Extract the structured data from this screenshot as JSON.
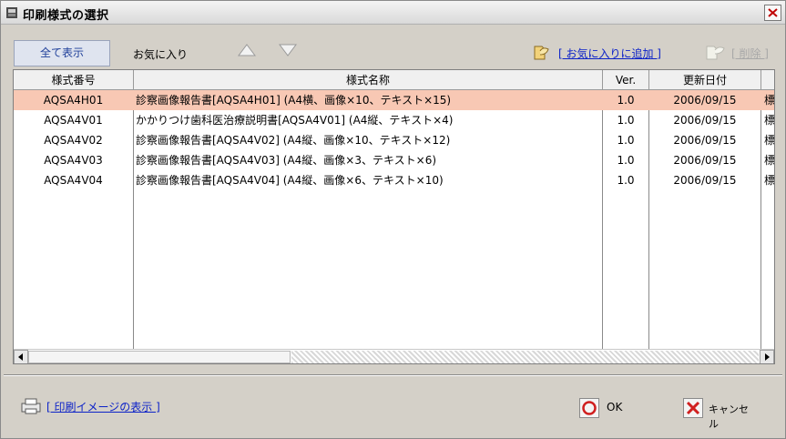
{
  "window": {
    "title": "印刷様式の選択"
  },
  "toolbar": {
    "tab_all": "全て表示",
    "tab_favorites": "お気に入り",
    "add_favorite": "[ お気に入りに追加 ]",
    "delete": "[ 削除 ]"
  },
  "table": {
    "columns": [
      "様式番号",
      "様式名称",
      "Ver.",
      "更新日付",
      ""
    ],
    "rows": [
      {
        "code": "AQSA4H01",
        "name": "診察画像報告書[AQSA4H01] (A4横、画像×10、テキスト×15)",
        "ver": "1.0",
        "date": "2006/09/15",
        "extra": "標"
      },
      {
        "code": "AQSA4V01",
        "name": "かかりつけ歯科医治療説明書[AQSA4V01] (A4縦、テキスト×4)",
        "ver": "1.0",
        "date": "2006/09/15",
        "extra": "標"
      },
      {
        "code": "AQSA4V02",
        "name": "診察画像報告書[AQSA4V02] (A4縦、画像×10、テキスト×12)",
        "ver": "1.0",
        "date": "2006/09/15",
        "extra": "標"
      },
      {
        "code": "AQSA4V03",
        "name": "診察画像報告書[AQSA4V03] (A4縦、画像×3、テキスト×6)",
        "ver": "1.0",
        "date": "2006/09/15",
        "extra": "標"
      },
      {
        "code": "AQSA4V04",
        "name": "診察画像報告書[AQSA4V04] (A4縦、画像×6、テキスト×10)",
        "ver": "1.0",
        "date": "2006/09/15",
        "extra": "標"
      }
    ]
  },
  "footer": {
    "print_preview": "[ 印刷イメージの表示 ]",
    "ok": "OK",
    "cancel": "キャンセル"
  },
  "colors": {
    "selected_row": "#f8c8b4",
    "link": "#0c22c8",
    "accent_tab": "#1f3f9a"
  }
}
